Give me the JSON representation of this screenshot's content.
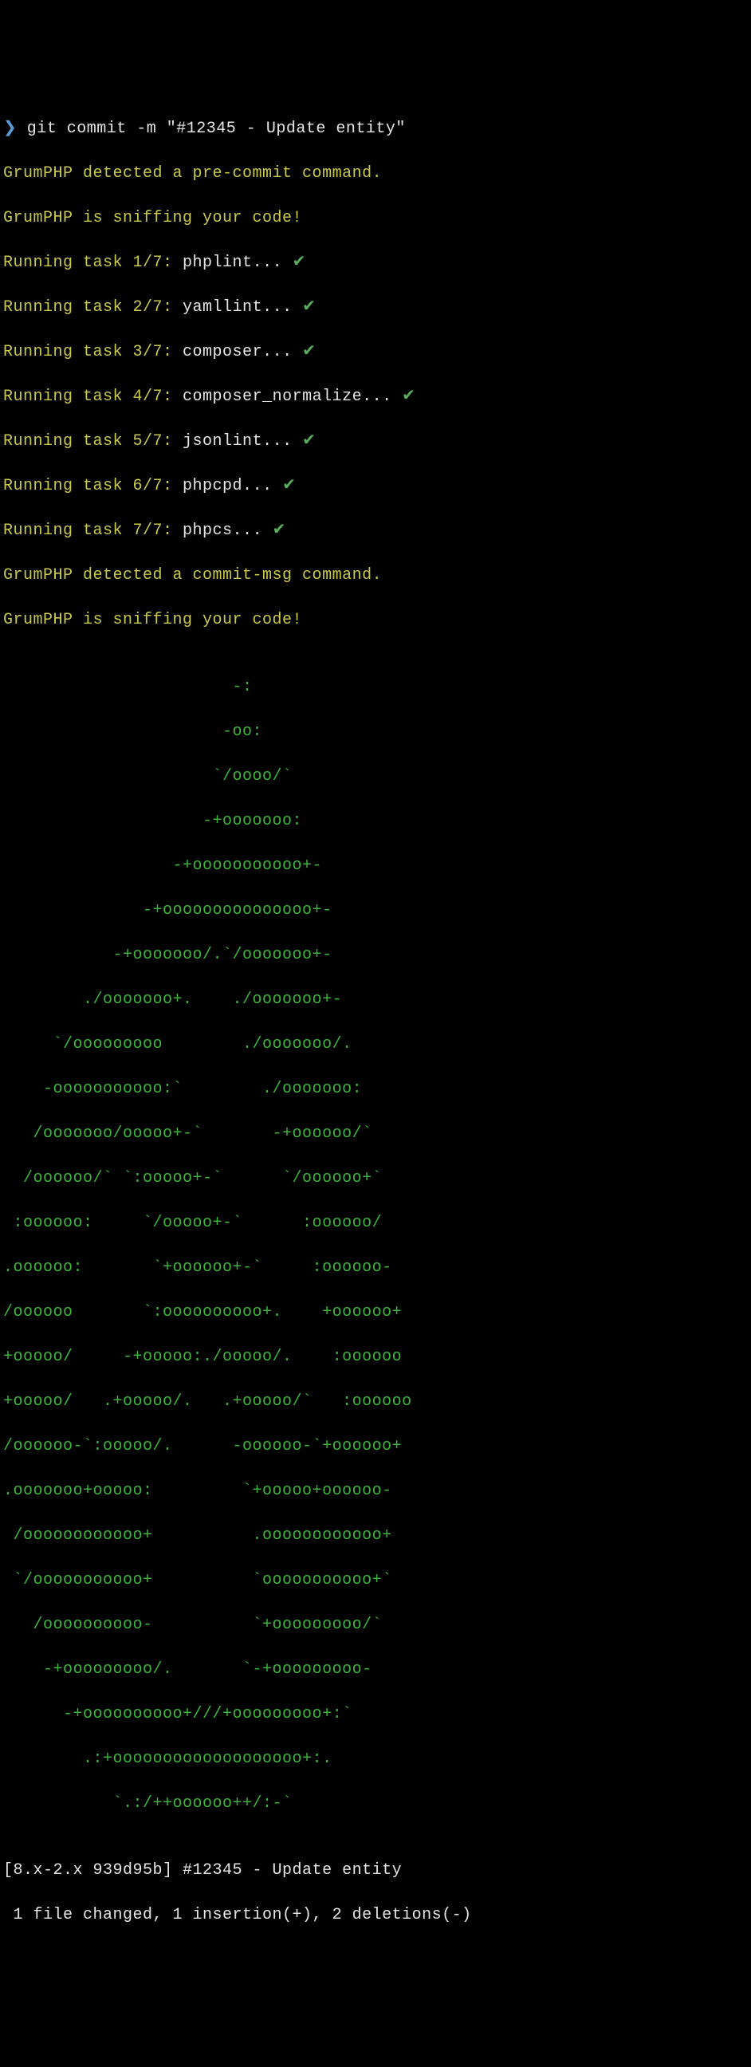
{
  "prompt": {
    "symbol": "❯",
    "command": " git commit -m \"#12345 - Update entity\""
  },
  "messages": {
    "precommit": "GrumPHP detected a pre-commit command.",
    "sniffing": "GrumPHP is sniffing your code!",
    "commitmsg": "GrumPHP detected a commit-msg command."
  },
  "tasks": [
    {
      "prefix": "Running task 1/7:",
      "name": " phplint... ",
      "check": "✔"
    },
    {
      "prefix": "Running task 2/7:",
      "name": " yamllint... ",
      "check": "✔"
    },
    {
      "prefix": "Running task 3/7:",
      "name": " composer... ",
      "check": "✔"
    },
    {
      "prefix": "Running task 4/7:",
      "name": " composer_normalize... ",
      "check": "✔"
    },
    {
      "prefix": "Running task 5/7:",
      "name": " jsonlint... ",
      "check": "✔"
    },
    {
      "prefix": "Running task 6/7:",
      "name": " phpcpd... ",
      "check": "✔"
    },
    {
      "prefix": "Running task 7/7:",
      "name": " phpcs... ",
      "check": "✔"
    }
  ],
  "ascii": [
    "                       -:",
    "                      -oo:",
    "                     `/oooo/`",
    "                    -+ooooooo:",
    "                 -+ooooooooooo+-",
    "              -+ooooooooooooooo+-",
    "           -+ooooooo/.`/ooooooo+-",
    "        ./ooooooo+.    ./ooooooo+-",
    "     `/ooooooooo        ./ooooooo/.",
    "    -ooooooooooo:`        ./ooooooo:",
    "   /ooooooo/ooooo+-`       -+oooooo/`",
    "  /oooooo/` `:ooooo+-`      `/oooooo+`",
    " :oooooo:     `/ooooo+-`      :oooooo/",
    ".oooooo:       `+oooooo+-`     :oooooo-",
    "/oooooo       `:oooooooooo+.    +oooooo+",
    "+ooooo/     -+ooooo:./ooooo/.    :oooooo",
    "+ooooo/   .+ooooo/.   .+ooooo/`   :oooooo",
    "/oooooo-`:ooooo/.      -oooooo-`+oooooo+",
    ".ooooooo+ooooo:         `+ooooo+oooooo-",
    " /oooooooooooo+          .oooooooooooo+",
    " `/ooooooooooo+          `ooooooooooo+`",
    "   /oooooooooo-          `+ooooooooo/`",
    "    -+ooooooooo/.       `-+ooooooooo-",
    "      -+oooooooooo+///+ooooooooo+:`",
    "        .:+ooooooooooooooooooo+:.",
    "           `.:/++oooooo++/:-`"
  ],
  "result": {
    "line1": "[8.x-2.x 939d95b] #12345 - Update entity",
    "line2": " 1 file changed, 1 insertion(+), 2 deletions(-)"
  }
}
